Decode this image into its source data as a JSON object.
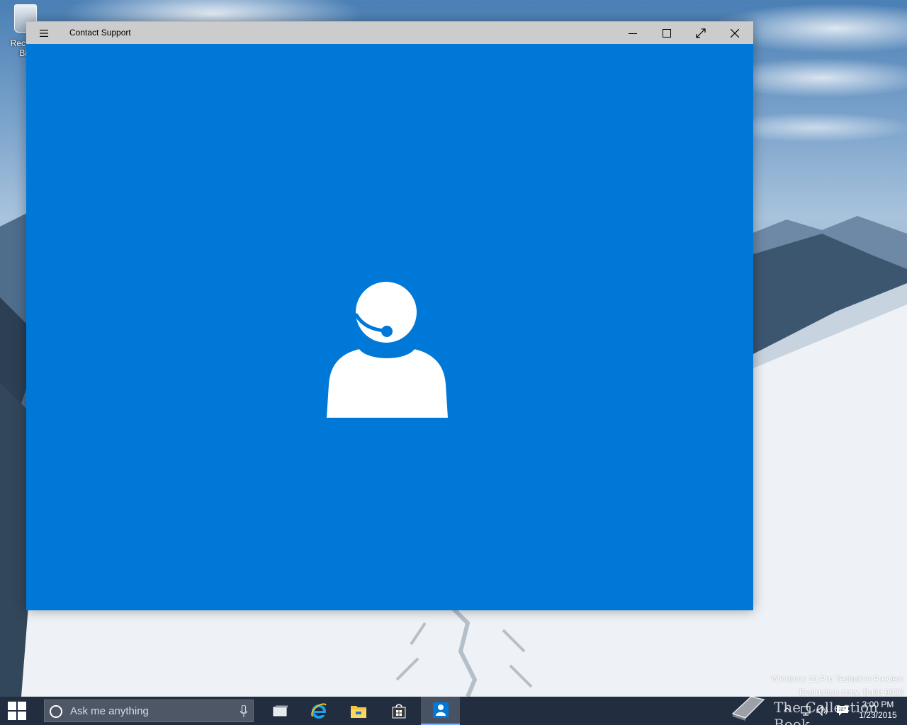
{
  "desktop": {
    "recycle_bin_label": "Recycle Bin",
    "watermark_line1": "Windows 10 Pro Technical Preview",
    "watermark_line2": "Evaluation copy. Build 9926",
    "overlay_text": "The Collection Book"
  },
  "window": {
    "title": "Contact Support",
    "accent_color": "#0078d7",
    "titlebar_color": "#cccccc",
    "icons": {
      "menu": "hamburger-icon",
      "minimize": "minimize-icon",
      "maximize": "maximize-icon",
      "full_screen": "full-screen-icon",
      "close": "close-icon",
      "logo": "support-agent-headset-icon"
    }
  },
  "taskbar": {
    "search_placeholder": "Ask me anything",
    "pinned": [
      "task-view-icon",
      "internet-explorer-icon",
      "file-explorer-icon",
      "store-icon",
      "contact-support-icon"
    ],
    "active_app": "contact-support-icon",
    "clock": {
      "time": "3:00 PM",
      "date": "1/23/2015"
    }
  }
}
